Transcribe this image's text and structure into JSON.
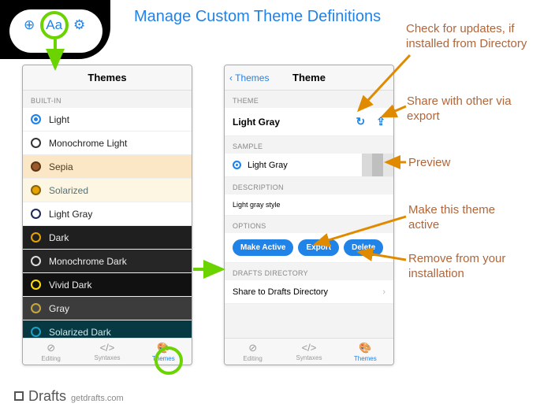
{
  "title": "Manage Custom Theme Definitions",
  "top_icons": {
    "zoom": "⊕",
    "font": "Aa",
    "gear": "⚙"
  },
  "left_phone": {
    "nav_title": "Themes",
    "section": "BUILT-IN",
    "themes": [
      {
        "name": "Light",
        "swatch_bg": "#ffffff",
        "swatch_border": "#2083e8",
        "row_bg": "#ffffff",
        "row_color": "#222",
        "selected": true
      },
      {
        "name": "Monochrome Light",
        "swatch_bg": "#ffffff",
        "swatch_border": "#333333",
        "row_bg": "#ffffff",
        "row_color": "#222"
      },
      {
        "name": "Sepia",
        "swatch_bg": "#9a5a2b",
        "swatch_border": "#5c3416",
        "row_bg": "#fbe7c6",
        "row_color": "#4b3b22"
      },
      {
        "name": "Solarized",
        "swatch_bg": "#e6a200",
        "swatch_border": "#8a6400",
        "row_bg": "#fdf6e3",
        "row_color": "#586e75"
      },
      {
        "name": "Light Gray",
        "swatch_bg": "#ffffff",
        "swatch_border": "#1b2a5b",
        "row_bg": "#ffffff",
        "row_color": "#222"
      },
      {
        "name": "Dark",
        "swatch_bg": "#222222",
        "swatch_border": "#e6a200",
        "row_bg": "#1f1f1f",
        "row_color": "#eeeeee"
      },
      {
        "name": "Monochrome Dark",
        "swatch_bg": "#222222",
        "swatch_border": "#dddddd",
        "row_bg": "#262626",
        "row_color": "#eeeeee"
      },
      {
        "name": "Vivid Dark",
        "swatch_bg": "#111111",
        "swatch_border": "#ffdd00",
        "row_bg": "#111111",
        "row_color": "#eeeeee"
      },
      {
        "name": "Gray",
        "swatch_bg": "#4a4a4a",
        "swatch_border": "#c7a63c",
        "row_bg": "#3c3c3c",
        "row_color": "#eeeeee"
      },
      {
        "name": "Solarized Dark",
        "swatch_bg": "#063942",
        "swatch_border": "#1fa0c6",
        "row_bg": "#063942",
        "row_color": "#cfe8ee"
      }
    ]
  },
  "right_phone": {
    "nav_back": "Themes",
    "nav_title": "Theme",
    "section_theme": "THEME",
    "theme_name": "Light Gray",
    "section_sample": "SAMPLE",
    "sample_name": "Light Gray",
    "section_desc": "DESCRIPTION",
    "description": "Light gray style",
    "section_options": "OPTIONS",
    "btn_active": "Make Active",
    "btn_export": "Export",
    "btn_delete": "Delete",
    "section_directory": "DRAFTS DIRECTORY",
    "share_row": "Share to Drafts Directory"
  },
  "tabbar": {
    "editing": "Editing",
    "syntaxes": "Syntaxes",
    "themes": "Themes"
  },
  "callouts": {
    "updates": "Check for updates, if installed from Directory",
    "share": "Share with other via export",
    "preview": "Preview",
    "active": "Make this theme active",
    "remove": "Remove from your installation"
  },
  "footer": {
    "brand": "Drafts",
    "domain": "getdrafts.com"
  }
}
